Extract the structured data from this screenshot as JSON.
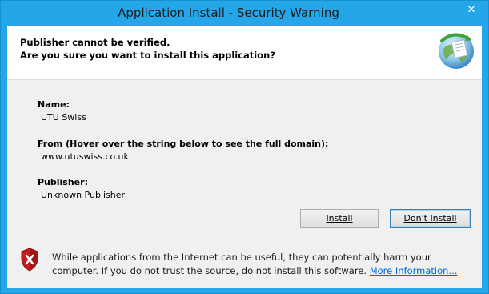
{
  "window": {
    "title": "Application Install - Security Warning",
    "close_glyph": "✕"
  },
  "header": {
    "line1": "Publisher cannot be verified.",
    "line2": "Are you sure you want to install this application?",
    "icon": "application-install-globe-icon"
  },
  "details": {
    "name_label": "Name:",
    "name_value": "UTU Swiss",
    "from_label": "From (Hover over the string below to see the full domain):",
    "from_value": "www.utuswiss.co.uk",
    "publisher_label": "Publisher:",
    "publisher_value": "Unknown Publisher"
  },
  "buttons": {
    "install_label": "Install",
    "dont_install_label": "Don't Install"
  },
  "footer": {
    "warning_text": "While applications from the Internet can be useful, they can potentially harm your computer. If you do not trust the source, do not install this software. ",
    "more_info_link": "More Information...",
    "icon": "security-shield-icon"
  },
  "colors": {
    "titlebar": "#24a6e8",
    "link": "#0066cc",
    "shield_red": "#c41e1e"
  }
}
